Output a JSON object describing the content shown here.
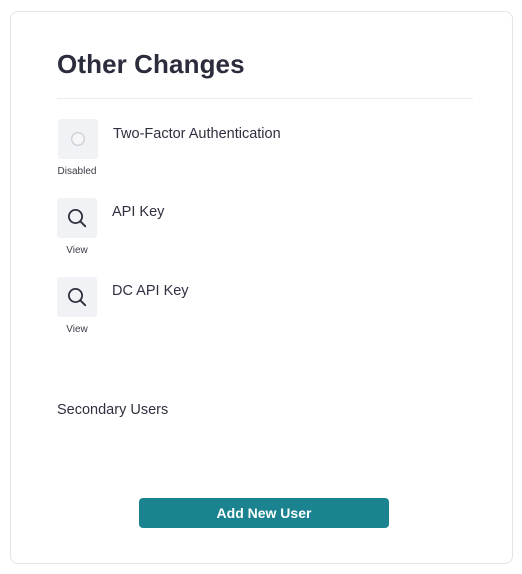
{
  "panel": {
    "title": "Other Changes"
  },
  "changes": [
    {
      "label": "Two-Factor Authentication",
      "action_label": "Disabled",
      "action_icon": "toggle-off-icon"
    },
    {
      "label": "API Key",
      "action_label": "View",
      "action_icon": "search-icon"
    },
    {
      "label": "DC API Key",
      "action_label": "View",
      "action_icon": "search-icon"
    }
  ],
  "secondary_users": {
    "title": "Secondary Users",
    "add_button_label": "Add New User"
  },
  "colors": {
    "accent": "#1a838f",
    "icon_box": "#f1f2f6",
    "text": "#2f3040"
  }
}
